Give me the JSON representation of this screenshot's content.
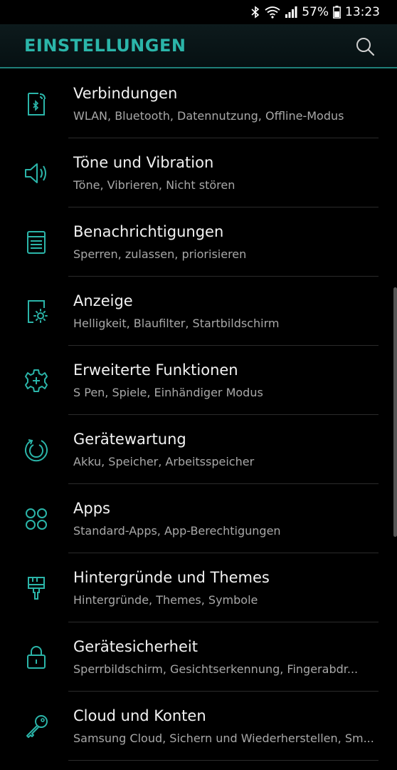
{
  "status_bar": {
    "battery_percent": "57%",
    "time": "13:23",
    "icons": [
      "bluetooth-icon",
      "wifi-icon",
      "signal-icon",
      "battery-icon"
    ]
  },
  "header": {
    "title": "EINSTELLUNGEN",
    "search_icon": "search-icon"
  },
  "accent_color": "#2bb5a9",
  "settings": [
    {
      "label": "Verbindungen",
      "sub": "WLAN, Bluetooth, Datennutzung, Offline-Modus",
      "icon": "connections-icon"
    },
    {
      "label": "Töne und Vibration",
      "sub": "Töne, Vibrieren, Nicht stören",
      "icon": "speaker-icon"
    },
    {
      "label": "Benachrichtigungen",
      "sub": "Sperren, zulassen, priorisieren",
      "icon": "notifications-icon"
    },
    {
      "label": "Anzeige",
      "sub": "Helligkeit, Blaufilter, Startbildschirm",
      "icon": "display-icon"
    },
    {
      "label": "Erweiterte Funktionen",
      "sub": "S Pen, Spiele, Einhändiger Modus",
      "icon": "gear-plus-icon"
    },
    {
      "label": "Gerätewartung",
      "sub": "Akku, Speicher, Arbeitsspeicher",
      "icon": "device-care-icon"
    },
    {
      "label": "Apps",
      "sub": "Standard-Apps, App-Berechtigungen",
      "icon": "apps-icon"
    },
    {
      "label": "Hintergründe und Themes",
      "sub": "Hintergründe, Themes, Symbole",
      "icon": "brush-icon"
    },
    {
      "label": "Gerätesicherheit",
      "sub": "Sperrbildschirm, Gesichtserkennung, Fingerabdr...",
      "icon": "lock-icon"
    },
    {
      "label": "Cloud und Konten",
      "sub": "Samsung Cloud, Sichern und Wiederherstellen, Sm...",
      "icon": "key-icon"
    }
  ]
}
